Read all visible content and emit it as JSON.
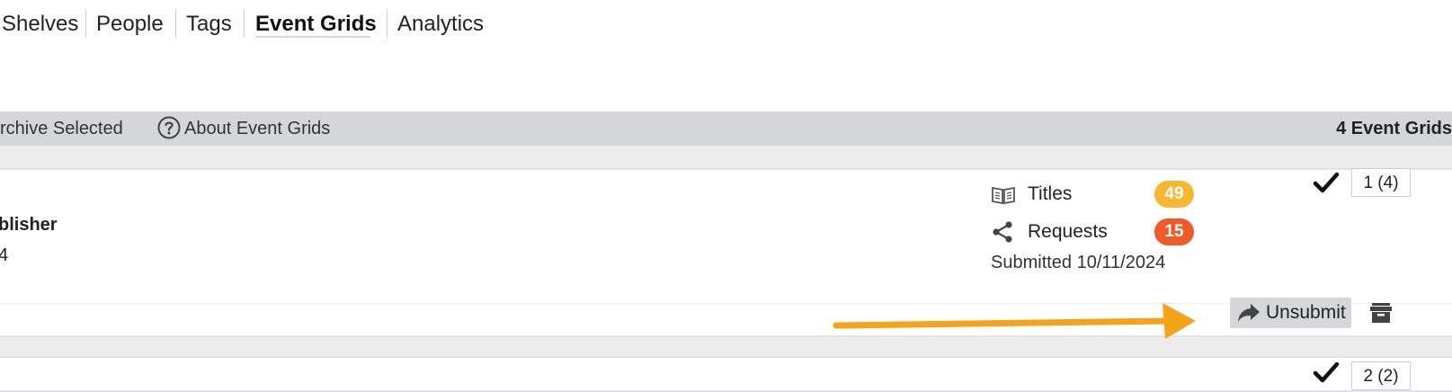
{
  "nav": {
    "items": [
      {
        "label": "Shelves"
      },
      {
        "label": "People"
      },
      {
        "label": "Tags"
      },
      {
        "label": "Event Grids"
      },
      {
        "label": "Analytics"
      }
    ],
    "active": "Event Grids"
  },
  "toolbar": {
    "archive_label": "rchive Selected",
    "about_label": "About Event Grids",
    "count_label": "4 Event Grids"
  },
  "grid": {
    "publisher_label": "blisher",
    "publisher_sub": "4",
    "titles_label": "Titles",
    "titles_count": "49",
    "requests_label": "Requests",
    "requests_count": "15",
    "submitted_label": "Submitted 10/11/2024",
    "page_label": "1 (4)",
    "unsubmit_label": "Unsubmit",
    "next_page_label": "2 (2)"
  },
  "colors": {
    "titles_badge": "#f7b731",
    "requests_badge": "#f05a28",
    "arrow": "#f5a31a",
    "toolbar_bg": "#d4d6d9"
  },
  "icons": {
    "help": "question-circle-icon",
    "titles": "open-book-icon",
    "requests": "share-icon",
    "check": "checkmark-icon",
    "unsubmit": "share-arrow-icon",
    "archive": "archive-box-icon"
  }
}
